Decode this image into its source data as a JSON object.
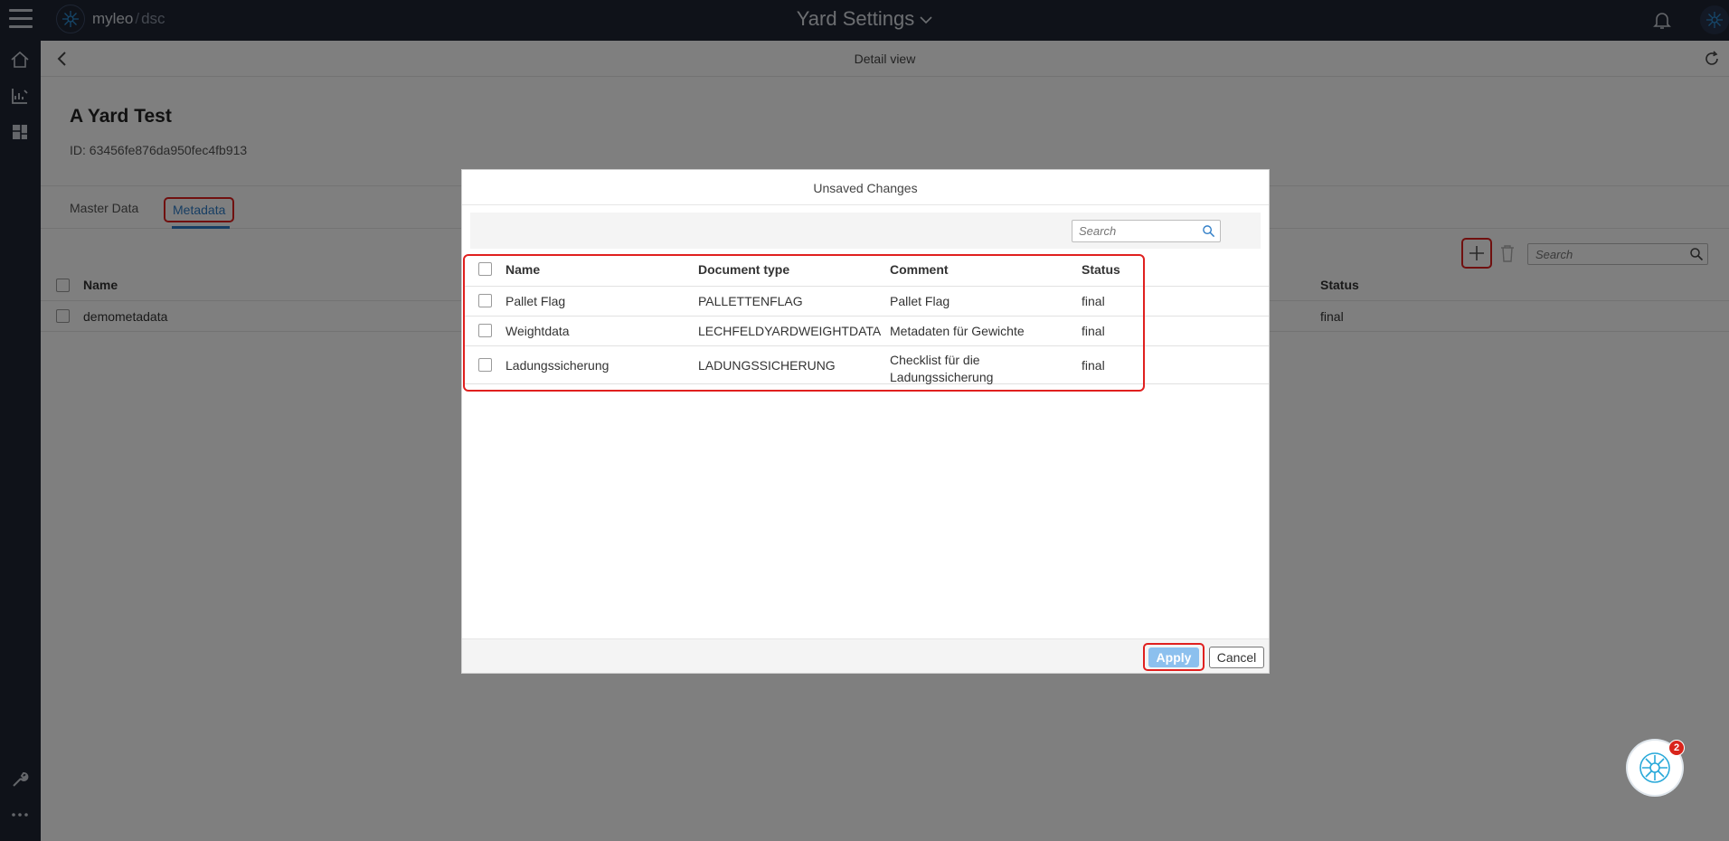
{
  "topbar": {
    "brand_main": "myleo",
    "brand_sep": "/",
    "brand_sub": "dsc",
    "title": "Yard Settings"
  },
  "subheader": {
    "title": "Detail view"
  },
  "record": {
    "title": "A Yard Test",
    "id": "ID: 63456fe876da950fec4fb913"
  },
  "tabs": [
    {
      "label": "Master Data"
    },
    {
      "label": "Metadata",
      "active": true
    }
  ],
  "background_table": {
    "search_placeholder": "Search",
    "columns": {
      "name": "Name",
      "status": "Status"
    },
    "rows": [
      {
        "name": "demometadata",
        "status": "final"
      }
    ]
  },
  "modal": {
    "title": "Unsaved Changes",
    "search_placeholder": "Search",
    "columns": {
      "name": "Name",
      "document_type": "Document type",
      "comment": "Comment",
      "status": "Status"
    },
    "rows": [
      {
        "name": "Pallet Flag",
        "document_type": "PALLETTENFLAG",
        "comment": "Pallet Flag",
        "status": "final"
      },
      {
        "name": "Weightdata",
        "document_type": "LECHFELDYARDWEIGHTDATA",
        "comment": "Metadaten für Gewichte",
        "status": "final"
      },
      {
        "name": "Ladungssicherung",
        "document_type": "LADUNGSSICHERUNG",
        "comment": "Checklist für die Ladungssicherung",
        "status": "final"
      }
    ],
    "apply_label": "Apply",
    "cancel_label": "Cancel"
  },
  "assistant": {
    "badge_count": "2"
  },
  "colors": {
    "topbar_bg": "#1e2533",
    "accent_blue": "#2f7dc7",
    "highlight_red": "#e0201f",
    "apply_bg": "#8cc0ee",
    "badge_red": "#d9241b"
  },
  "icons": [
    "hamburger-icon",
    "logo-icon",
    "chevron-down-icon",
    "bell-icon",
    "home-icon",
    "chart-icon",
    "dashboard-icon",
    "wrench-icon",
    "more-icon",
    "back-icon",
    "refresh-icon",
    "plus-icon",
    "trash-icon",
    "search-icon",
    "assistant-icon"
  ]
}
